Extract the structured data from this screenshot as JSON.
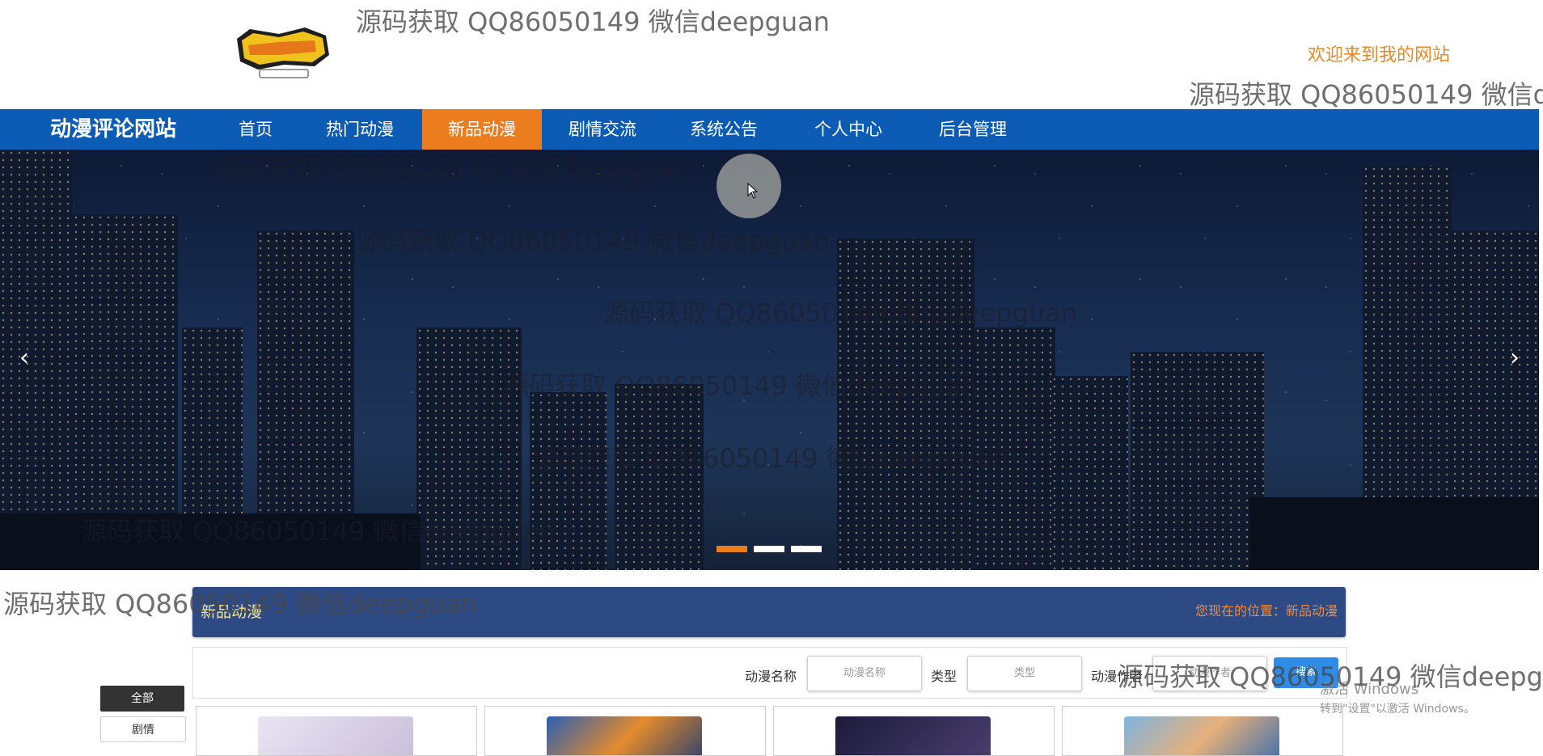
{
  "watermark_text": "源码获取 QQ86050149 微信deepguan",
  "header": {
    "welcome": "欢迎来到我的网站"
  },
  "nav": {
    "brand": "动漫评论网站",
    "items": [
      {
        "label": "首页"
      },
      {
        "label": "热门动漫"
      },
      {
        "label": "新品动漫",
        "active": true
      },
      {
        "label": "剧情交流"
      },
      {
        "label": "系统公告"
      },
      {
        "label": "个人中心"
      },
      {
        "label": "后台管理"
      }
    ]
  },
  "banner": {
    "prev": "‹",
    "next": "›",
    "slides": 3,
    "active_slide": 1
  },
  "section": {
    "title": "新品动漫",
    "location": "您现在的位置：新品动漫"
  },
  "search": {
    "name_label": "动漫名称",
    "name_placeholder": "动漫名称",
    "type_label": "类型",
    "type_placeholder": "类型",
    "author_label": "动漫作者",
    "author_placeholder": "动漫作者",
    "button": "搜索"
  },
  "filters": [
    "全部",
    "剧情"
  ],
  "windows": {
    "line1": "激活 Windows",
    "line2": "转到\"设置\"以激活 Windows。"
  },
  "colors": {
    "nav": "#0c5cb5",
    "accent": "#ec7d1f",
    "section": "#2d4a85",
    "search_button": "#2e8ce6"
  }
}
